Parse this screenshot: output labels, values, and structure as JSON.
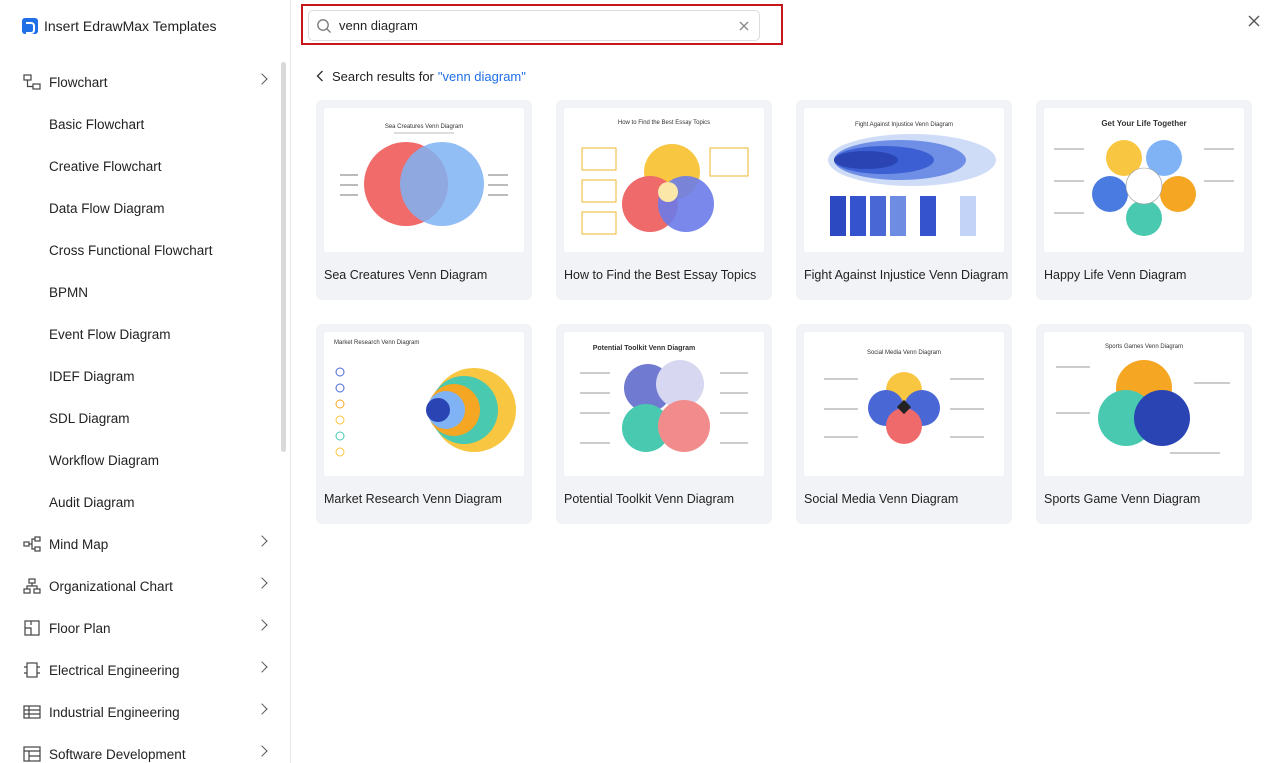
{
  "app": {
    "title": "Insert EdrawMax Templates"
  },
  "sidebar": {
    "items": [
      {
        "label": "Flowchart",
        "type": "category",
        "icon": "flowchart-icon",
        "expanded": true
      },
      {
        "label": "Basic Flowchart",
        "type": "sub"
      },
      {
        "label": "Creative Flowchart",
        "type": "sub"
      },
      {
        "label": "Data Flow Diagram",
        "type": "sub"
      },
      {
        "label": "Cross Functional Flowchart",
        "type": "sub"
      },
      {
        "label": "BPMN",
        "type": "sub"
      },
      {
        "label": "Event Flow Diagram",
        "type": "sub"
      },
      {
        "label": "IDEF Diagram",
        "type": "sub"
      },
      {
        "label": "SDL Diagram",
        "type": "sub"
      },
      {
        "label": "Workflow Diagram",
        "type": "sub"
      },
      {
        "label": "Audit Diagram",
        "type": "sub"
      },
      {
        "label": "Mind Map",
        "type": "category",
        "icon": "mind-map-icon"
      },
      {
        "label": "Organizational Chart",
        "type": "category",
        "icon": "org-chart-icon"
      },
      {
        "label": "Floor Plan",
        "type": "category",
        "icon": "floor-plan-icon"
      },
      {
        "label": "Electrical Engineering",
        "type": "category",
        "icon": "electrical-icon"
      },
      {
        "label": "Industrial Engineering",
        "type": "category",
        "icon": "industrial-icon"
      },
      {
        "label": "Software Development",
        "type": "category",
        "icon": "software-icon"
      }
    ]
  },
  "search": {
    "value": "venn diagram",
    "placeholder": ""
  },
  "results": {
    "prefix": "Search results for",
    "query": "\"venn diagram\""
  },
  "colors": {
    "accent": "#1f6fe6",
    "highlight_border": "#c8161d",
    "card_bg": "#f2f3f7"
  },
  "templates": [
    {
      "name": "Sea Creatures Venn Diagram",
      "thumb_title": "Sea Creatures Venn Diagram"
    },
    {
      "name": "How to Find the Best Essay Topics",
      "thumb_title": "How to Find the Best Essay Topics"
    },
    {
      "name": "Fight Against Injustice Venn Diagram",
      "thumb_title": "Fight Against Injustice Venn Diagram"
    },
    {
      "name": "Happy Life Venn Diagram",
      "thumb_title": "Get Your Life Together"
    },
    {
      "name": "Market Research Venn Diagram",
      "thumb_title": "Market Research Venn Diagram"
    },
    {
      "name": "Potential Toolkit Venn Diagram",
      "thumb_title": "Potential Toolkit Venn Diagram"
    },
    {
      "name": "Social Media Venn Diagram",
      "thumb_title": "Social Media Venn Diagram"
    },
    {
      "name": "Sports Game Venn Diagram",
      "thumb_title": "Sports Games Venn Diagram"
    }
  ]
}
